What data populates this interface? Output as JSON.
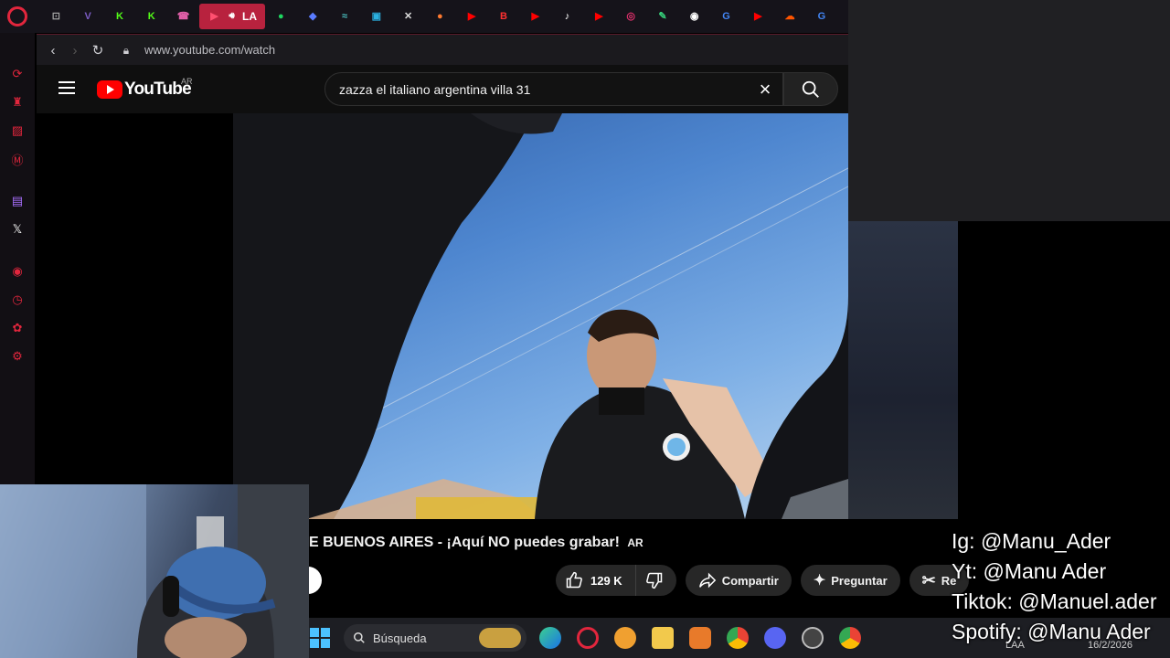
{
  "browser": {
    "tabs": [
      {
        "icon": "gamepad-icon",
        "color": "#a0a0a0",
        "glyph": "⊡"
      },
      {
        "icon": "v-icon",
        "color": "#7b5cc4",
        "glyph": "V"
      },
      {
        "icon": "kick-icon",
        "color": "#53fc18",
        "glyph": "K"
      },
      {
        "icon": "kick-icon",
        "color": "#53fc18",
        "glyph": "K"
      },
      {
        "icon": "phone-icon",
        "color": "#e05fa8",
        "glyph": "☎"
      }
    ],
    "active_tab_label": "LA",
    "tabs_right": [
      {
        "icon": "spotify-icon",
        "color": "#1ed760",
        "glyph": "●"
      },
      {
        "icon": "drop-icon",
        "color": "#5a7cff",
        "glyph": "◆"
      },
      {
        "icon": "wave-icon",
        "color": "#4ac0c0",
        "glyph": "≈"
      },
      {
        "icon": "map-icon",
        "color": "#2ab0e0",
        "glyph": "▣"
      },
      {
        "icon": "x-icon",
        "color": "#dddddd",
        "glyph": "✕"
      },
      {
        "icon": "orange-icon",
        "color": "#ff7a30",
        "glyph": "●"
      },
      {
        "icon": "youtube-icon",
        "color": "#ff0000",
        "glyph": "▶"
      },
      {
        "icon": "b-icon",
        "color": "#ff3030",
        "glyph": "B"
      },
      {
        "icon": "youtube-icon",
        "color": "#ff0000",
        "glyph": "▶"
      },
      {
        "icon": "tiktok-icon",
        "color": "#ffffff",
        "glyph": "♪"
      },
      {
        "icon": "youtube-icon",
        "color": "#ff0000",
        "glyph": "▶"
      },
      {
        "icon": "instagram-icon",
        "color": "#e1306c",
        "glyph": "◎"
      },
      {
        "icon": "chat-icon",
        "color": "#36d07a",
        "glyph": "✎"
      },
      {
        "icon": "circle-icon",
        "color": "#ffffff",
        "glyph": "◉"
      },
      {
        "icon": "google-icon",
        "color": "#4285f4",
        "glyph": "G"
      },
      {
        "icon": "youtube-icon",
        "color": "#ff0000",
        "glyph": "▶"
      },
      {
        "icon": "soundcloud-icon",
        "color": "#ff5500",
        "glyph": "☁"
      },
      {
        "icon": "google-icon",
        "color": "#4285f4",
        "glyph": "G"
      }
    ],
    "url": "www.youtube.com/watch"
  },
  "youtube": {
    "logo_text": "YouTube",
    "region": "AR",
    "search_query": "zazza el italiano argentina villa 31",
    "video_title": "E BUENOS AIRES - ¡Aquí NO puedes grabar!",
    "title_badge": "AR",
    "like_count": "129 K",
    "share_label": "Compartir",
    "ask_label": "Preguntar",
    "clip_label": "Re"
  },
  "taskbar": {
    "search_placeholder": "Búsqueda",
    "lang": "LAA",
    "date": "16/2/2026"
  },
  "socials": {
    "ig": "Ig: @Manu_Ader",
    "yt": "Yt: @Manu Ader",
    "tiktok": "Tiktok: @Manuel.ader",
    "spotify": "Spotify: @Manu Ader"
  }
}
